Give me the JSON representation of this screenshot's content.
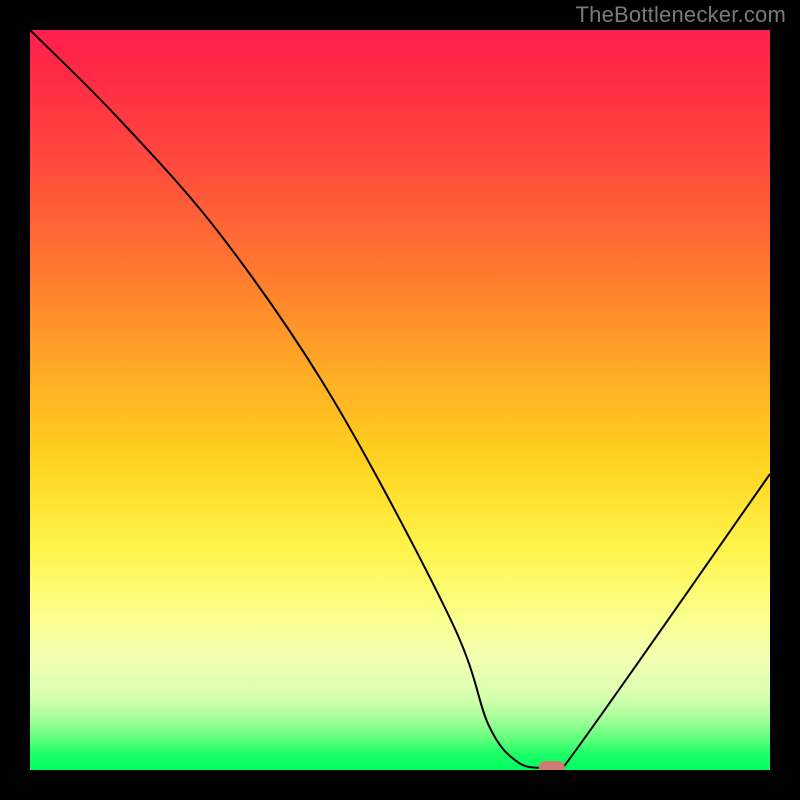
{
  "attribution": "TheBottlenecker.com",
  "chart_data": {
    "type": "line",
    "title": "",
    "xlabel": "",
    "ylabel": "",
    "xlim": [
      0,
      100
    ],
    "ylim": [
      0,
      100
    ],
    "series": [
      {
        "name": "bottleneck-curve",
        "x": [
          0,
          12,
          26,
          41,
          57,
          62,
          66,
          70,
          72,
          100
        ],
        "values": [
          100,
          88,
          72,
          50,
          20,
          6,
          1,
          0,
          0,
          40
        ]
      }
    ],
    "marker": {
      "x": 70.5,
      "y": 0.3,
      "shape": "rounded-rect"
    },
    "background": {
      "type": "vertical-gradient",
      "stops": [
        {
          "pos": 0,
          "color": "#ff1f4f"
        },
        {
          "pos": 33,
          "color": "#ff7a2f"
        },
        {
          "pos": 58,
          "color": "#ffd21f"
        },
        {
          "pos": 79,
          "color": "#fbff8a"
        },
        {
          "pos": 93,
          "color": "#a6ff9a"
        },
        {
          "pos": 100,
          "color": "#00ff5e"
        }
      ]
    }
  }
}
